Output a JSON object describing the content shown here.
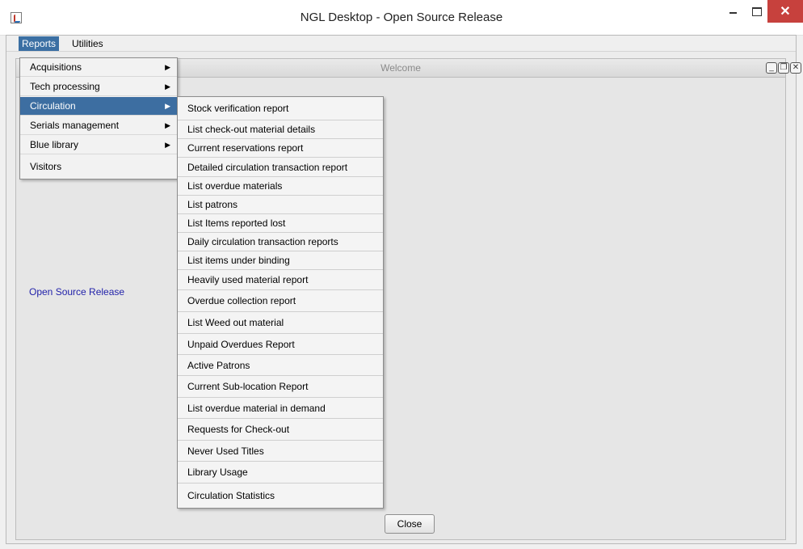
{
  "window": {
    "title": "NGL Desktop - Open Source Release",
    "close_glyph": "✕"
  },
  "menubar": {
    "items": [
      "Reports",
      "Utilities"
    ]
  },
  "internal_frame": {
    "title": "Welcome",
    "label": "Open Source Release",
    "close_button": "Close"
  },
  "reports_menu": {
    "items": [
      {
        "label": "Acquisitions",
        "has_submenu": true
      },
      {
        "label": "Tech processing",
        "has_submenu": true
      },
      {
        "label": "Circulation",
        "has_submenu": true,
        "selected": true
      },
      {
        "label": "Serials management",
        "has_submenu": true
      },
      {
        "label": "Blue library",
        "has_submenu": true
      },
      {
        "label": "Visitors",
        "has_submenu": false
      }
    ],
    "arrow_glyph": "▶"
  },
  "circulation_submenu": {
    "items": [
      "Stock verification report",
      "List check-out material details",
      "Current reservations report",
      "Detailed circulation transaction report",
      "List overdue materials",
      "List patrons",
      "List Items reported lost",
      "Daily circulation transaction reports",
      "List items under binding",
      "Heavily used material report",
      "Overdue collection report",
      "List Weed out material",
      "Unpaid Overdues Report",
      "Active Patrons",
      "Current Sub-location Report",
      "List overdue material in demand",
      "Requests for Check-out",
      "Never Used Titles",
      "Library Usage",
      "Circulation Statistics"
    ]
  },
  "colors": {
    "selection": "#3d6ea1",
    "close_button_red": "#c7413d",
    "link_blue": "#2222aa"
  }
}
